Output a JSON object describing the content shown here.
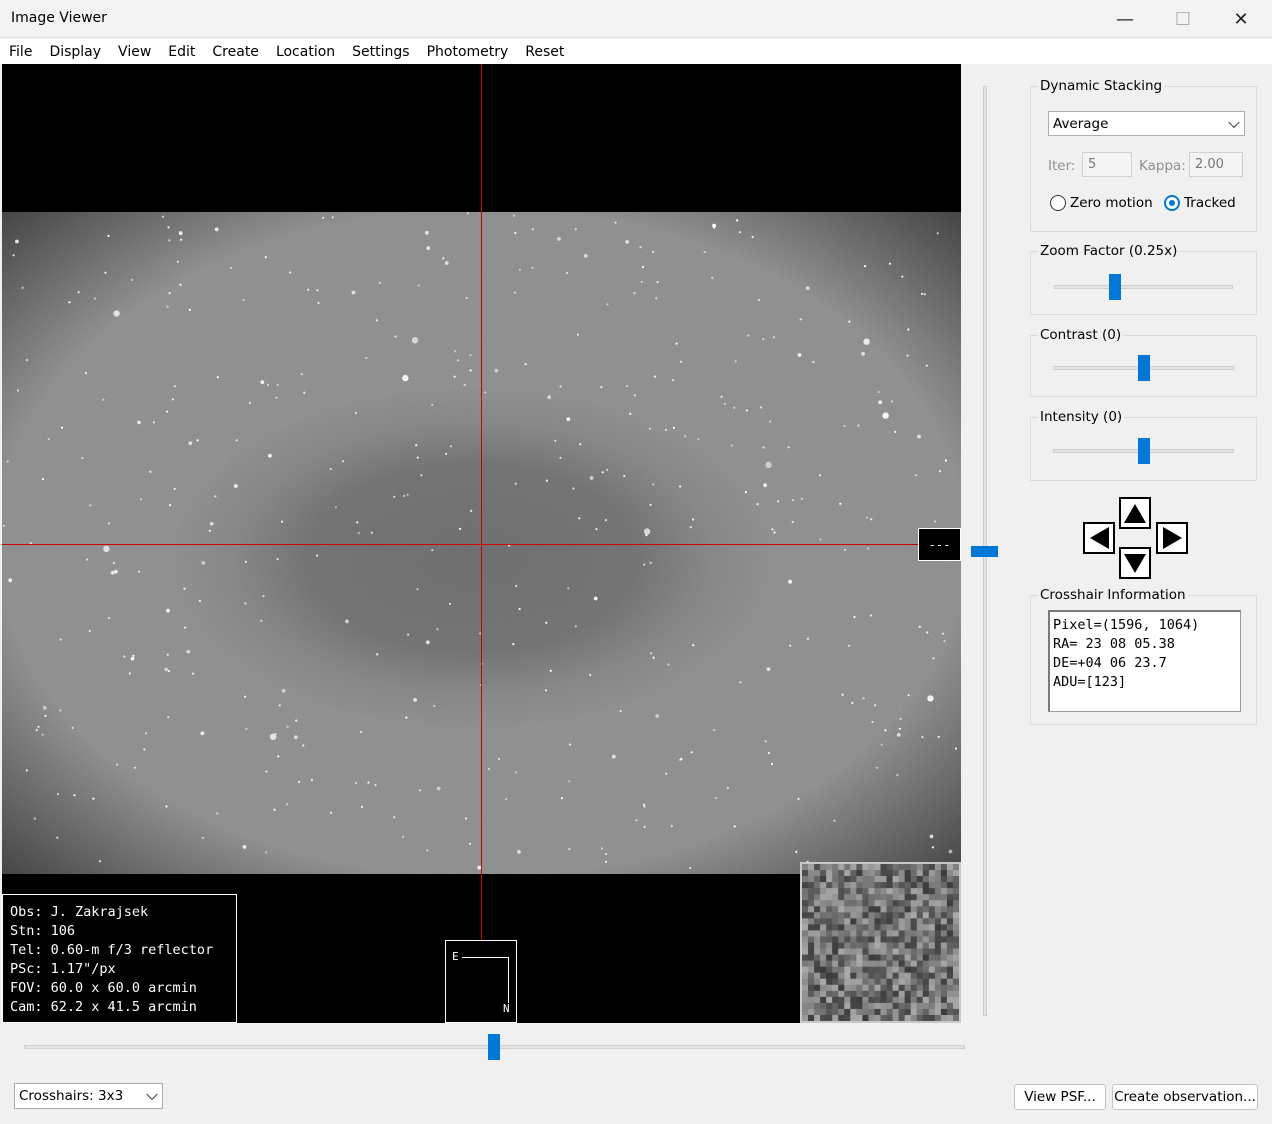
{
  "window": {
    "title": "Image Viewer",
    "minimize_glyph": "—",
    "maximize_glyph": "☐",
    "close_glyph": "✕"
  },
  "menu": [
    "File",
    "Display",
    "View",
    "Edit",
    "Create",
    "Location",
    "Settings",
    "Photometry",
    "Reset"
  ],
  "viewport": {
    "marker_text": "---",
    "info_lines": [
      "Obs: J. Zakrajsek",
      "Stn: 106",
      "Tel: 0.60-m f/3 reflector",
      "PSc: 1.17\"/px",
      "FOV: 60.0 x 60.0 arcmin",
      "Cam: 62.2 x 41.5 arcmin"
    ],
    "compass": {
      "east": "E",
      "north": "N"
    }
  },
  "dynamic_stacking": {
    "title": "Dynamic Stacking",
    "mode": "Average",
    "iter_label": "Iter:",
    "iter_value": "5",
    "kappa_label": "Kappa:",
    "kappa_value": "2.00",
    "radio_zero": "Zero motion",
    "radio_tracked": "Tracked",
    "selected": "Tracked"
  },
  "zoom": {
    "title": "Zoom Factor (0.25x)",
    "level": 0.34
  },
  "contrast": {
    "title": "Contrast (0)",
    "level": 0.5
  },
  "intensity": {
    "title": "Intensity (0)",
    "level": 0.5
  },
  "vertical_slider": {
    "level": 0.5
  },
  "horizontal_slider": {
    "level": 0.5
  },
  "crosshair_info": {
    "title": "Crosshair Information",
    "lines": [
      "Pixel=(1596, 1064)",
      "RA= 23 08 05.38",
      "DE=+04 06 23.7",
      "ADU=[123]"
    ]
  },
  "bottom": {
    "crosshairs_select": "Crosshairs: 3x3",
    "view_psf": "View PSF...",
    "create_observation": "Create observation..."
  },
  "colors": {
    "accent": "#0078d7",
    "crosshair": "#d00000"
  }
}
